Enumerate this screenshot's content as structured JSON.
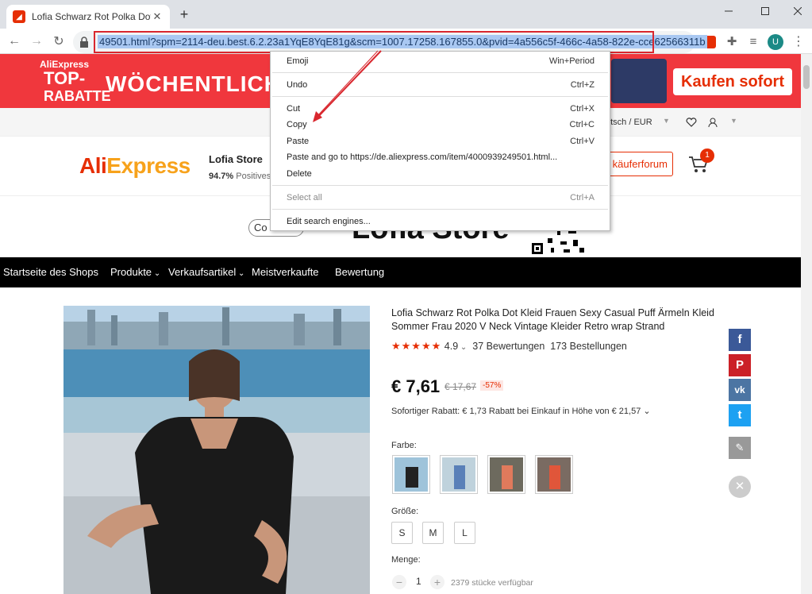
{
  "browser": {
    "tab_title": "Lofia Schwarz Rot Polka Dot Kleid",
    "tab_close": "✕",
    "new_tab": "+",
    "url_selected": "49501.html?spm=2114-deu.best.6.2.23a1YqE8YqE81g&scm=1007.17258.167855.0&pvid=4a556c5f-466c-4a58-822e-cce62566311b",
    "profile_initial": "U"
  },
  "banner": {
    "logo_top": "AliExpress",
    "logo_mid": "TOP-",
    "logo_bottom": "RABATTE",
    "headline": "WÖCHENTLICH",
    "cta": "Kaufen sofort"
  },
  "topbar": {
    "language_currency": "utsch /  EUR"
  },
  "header": {
    "logo_a": "AliExpress",
    "store_name": "Lofia Store",
    "positive_pct": "94.7%",
    "positive_label": "Positives",
    "forum_button": "käuferforum",
    "cart_count": "1"
  },
  "store_banner": {
    "collect_button": "Co",
    "store_title": "Lofia Store"
  },
  "nav": {
    "items": [
      "Startseite des Shops",
      "Produkte",
      "Verkaufsartikel",
      "Meistverkaufte",
      "Bewertung"
    ]
  },
  "product": {
    "title": "Lofia Schwarz Rot Polka Dot Kleid Frauen Sexy Casual Puff Ärmeln Kleid Sommer Frau 2020 V Neck Vintage Kleider Retro wrap Strand",
    "stars": "★★★★★",
    "rating": "4.9",
    "reviews": "37 Bewertungen",
    "orders": "173 Bestellungen",
    "price": "€ 7,61",
    "old_price": "€ 17,67",
    "discount": "-57%",
    "instant_discount": "Sofortiger Rabatt: € 1,73 Rabatt bei Einkauf in Höhe von € 21,57",
    "color_label": "Farbe:",
    "size_label": "Größe:",
    "sizes": [
      "S",
      "M",
      "L"
    ],
    "quantity_label": "Menge:",
    "quantity": "1",
    "stock": "2379 stücke verfügbar"
  },
  "share": {
    "facebook": "f",
    "pinterest": "P",
    "vk": "vk",
    "twitter": "t"
  },
  "context_menu": {
    "items": [
      {
        "label": "Emoji",
        "shortcut": "Win+Period"
      },
      {
        "label": "Undo",
        "shortcut": "Ctrl+Z"
      },
      {
        "label": "Cut",
        "shortcut": "Ctrl+X"
      },
      {
        "label": "Copy",
        "shortcut": "Ctrl+C"
      },
      {
        "label": "Paste",
        "shortcut": "Ctrl+V"
      },
      {
        "label": "Paste and go to https://de.aliexpress.com/item/4000939249501.html...",
        "shortcut": ""
      },
      {
        "label": "Delete",
        "shortcut": ""
      },
      {
        "label": "Select all",
        "shortcut": "Ctrl+A"
      },
      {
        "label": "Edit search engines...",
        "shortcut": ""
      }
    ]
  },
  "colors": {
    "accent": "#e62e04",
    "banner": "#f0373d",
    "highlight": "#d9272e"
  }
}
